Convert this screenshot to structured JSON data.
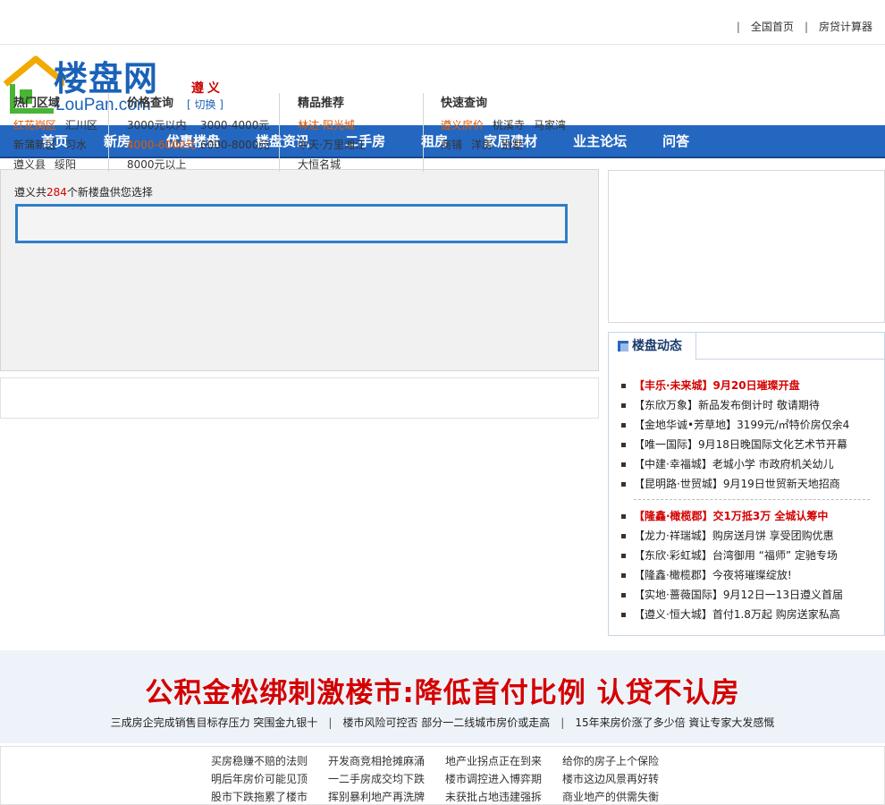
{
  "toplinks": {
    "home": "全国首页",
    "calculator": "房贷计算器",
    "sep": "|"
  },
  "logo": {
    "cn": "楼盘网",
    "en": "LouPan.com"
  },
  "city": {
    "name": "遵义",
    "switch": "[ 切换 ]"
  },
  "nav": [
    "首页",
    "新房",
    "优惠楼盘",
    "楼盘资讯",
    "二手房",
    "租房",
    "家居建材",
    "业主论坛",
    "问答"
  ],
  "search": {
    "prefix": "遵义共",
    "count": "284",
    "suffix": "个新楼盘供您选择",
    "placeholder": ""
  },
  "columns": {
    "hot": {
      "title": "热门区域",
      "rows": [
        [
          "红花岗区",
          "汇川区"
        ],
        [
          "新蒲新区",
          "习水"
        ],
        [
          "遵义县",
          "绥阳"
        ]
      ]
    },
    "price": {
      "title": "价格查询",
      "rows": [
        [
          "3000元以内",
          "3000-4000元"
        ],
        [
          "4000-6000元",
          "6000-8000元"
        ],
        [
          "8000元以上"
        ]
      ]
    },
    "featured": {
      "title": "精品推荐",
      "rows": [
        [
          "林达·阳光城"
        ],
        [
          "中天·万里湘江"
        ],
        [
          "大恒名城"
        ]
      ]
    },
    "quick": {
      "title": "快速查询",
      "rows": [
        [
          "遵义房价",
          "桃溪寺",
          "马家湾"
        ],
        [
          "商铺",
          "洋房",
          "别墅"
        ]
      ]
    }
  },
  "colors": {
    "nav": "#2467c1",
    "accent": "#d40000",
    "highlight": "#e05a00"
  },
  "news": {
    "tab": "楼盘动态",
    "group1": [
      "【丰乐·未来城】9月20日璀璨开盘",
      "【东欣万象】新品发布倒计时  敬请期待",
      "【金地华诚•芳草地】3199元/㎡特价房仅余4",
      "【唯一国际】9月18日晚国际文化艺术节开幕",
      "【中建·幸福城】老城小学  市政府机关幼儿",
      "【昆明路·世贸城】9月19日世贸新天地招商"
    ],
    "group2": [
      "【隆鑫·橄榄郡】交1万抵3万  全城认筹中",
      "【龙力·祥瑞城】购房送月饼  享受团购优惠",
      "【东欣·彩虹城】台湾御用 “福师” 定驰专场",
      "【隆鑫·橄榄郡】今夜将璀璨绽放!",
      "【实地·蔷薇国际】9月12日一13日遵义首届",
      "【遵义·恒大城】首付1.8万起  购房送家私高"
    ]
  },
  "banner": {
    "headline": "公积金松绑刺激楼市:降低首付比例 认贷不认房",
    "subs": [
      "三成房企完成销售目标存压力  突围金九银十",
      "楼市风险可控否  部分一二线城市房价或走高",
      "15年来房价涨了多少倍  資让专家大发感慨"
    ]
  },
  "bottom": [
    "买房稳赚不赔的法则",
    "开发商竞相抢摊麻涌",
    "地产业拐点正在到来",
    "给你的房子上个保险",
    "明后年房价可能见顶",
    "一二手房成交均下跌",
    "楼市调控进入博弈期",
    "楼市这边风景再好转",
    "股市下跌拖累了楼市",
    "挥别暴利地产再洗牌",
    "未获批占地违建强拆",
    "商业地产的供需失衡"
  ]
}
